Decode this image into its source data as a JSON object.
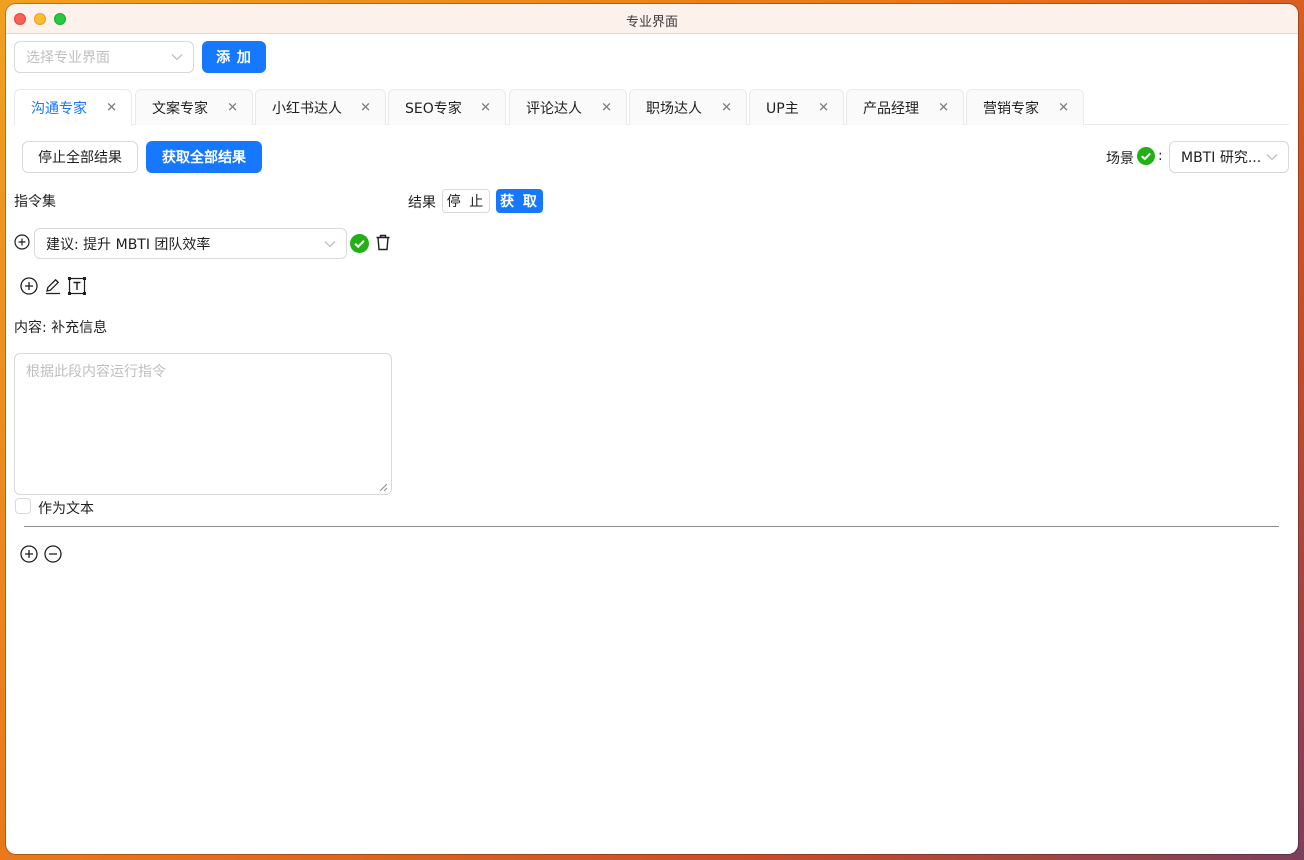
{
  "window": {
    "title": "专业界面"
  },
  "toolbar": {
    "select_placeholder": "选择专业界面",
    "add_label": "添 加"
  },
  "tabs": [
    {
      "label": "沟通专家",
      "active": true
    },
    {
      "label": "文案专家"
    },
    {
      "label": "小红书达人"
    },
    {
      "label": "SEO专家"
    },
    {
      "label": "评论达人"
    },
    {
      "label": "职场达人"
    },
    {
      "label": "UP主"
    },
    {
      "label": "产品经理"
    },
    {
      "label": "营销专家"
    }
  ],
  "actions": {
    "stop_all_label": "停止全部结果",
    "get_all_label": "获取全部结果"
  },
  "scene": {
    "label": "场景",
    "separator": ":",
    "value": "MBTI 研究..."
  },
  "commands": {
    "header": "指令集",
    "selected": "建议: 提升 MBTI 团队效率"
  },
  "results": {
    "label": "结果",
    "stop_label": "停 止",
    "get_label": "获 取"
  },
  "content": {
    "label": "内容: 补充信息",
    "placeholder": "根据此段内容运行指令",
    "as_text_label": "作为文本"
  },
  "colors": {
    "accent": "#1677ff",
    "success": "#22b014"
  }
}
